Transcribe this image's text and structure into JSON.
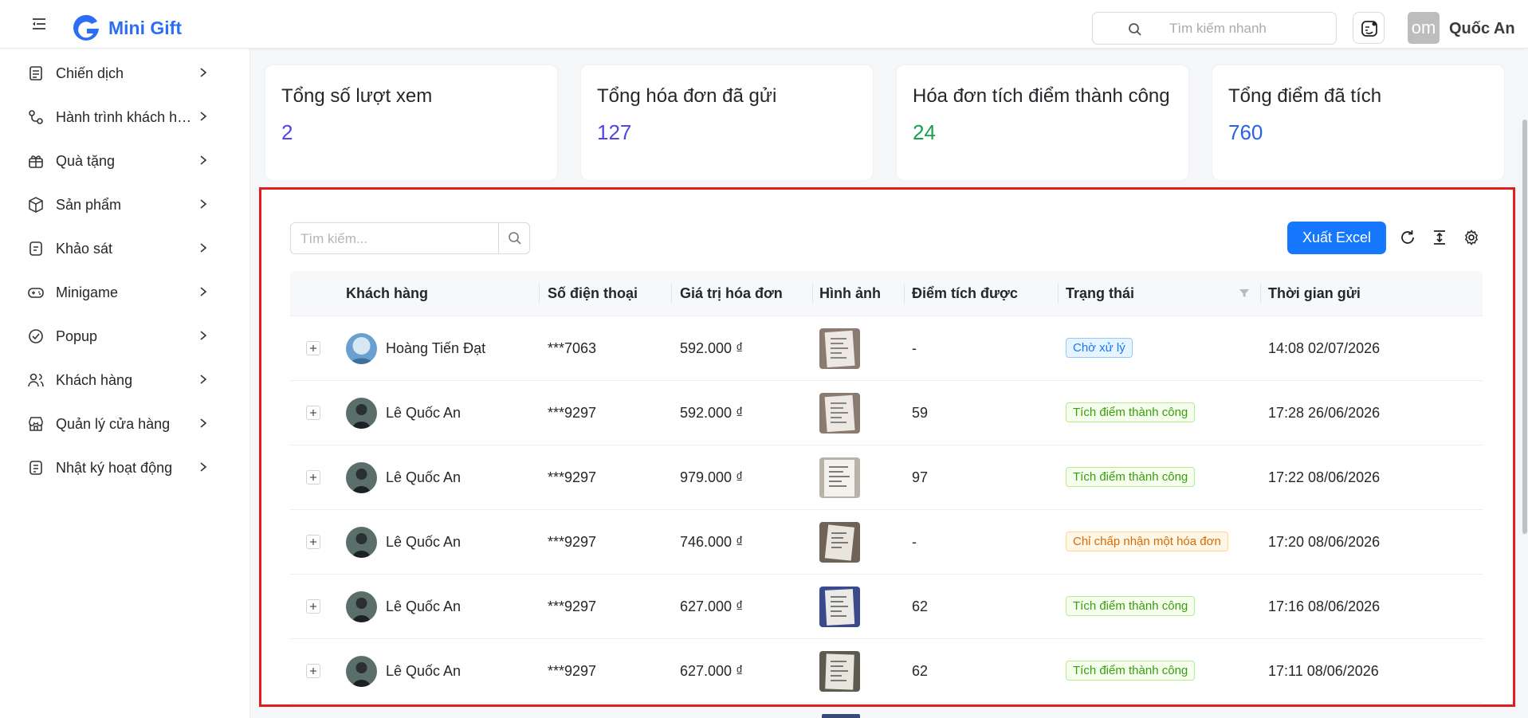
{
  "app": {
    "brand": "Mini Gift",
    "quick_search_placeholder": "Tìm kiếm nhanh",
    "user_avatar_text": "om",
    "user_name": "Quốc An"
  },
  "sidebar": {
    "items": [
      {
        "label": "Chiến dịch",
        "icon": "campaign-icon"
      },
      {
        "label": "Hành trình khách hàng",
        "icon": "journey-icon"
      },
      {
        "label": "Quà tặng",
        "icon": "gift-icon"
      },
      {
        "label": "Sản phẩm",
        "icon": "product-box-icon"
      },
      {
        "label": "Khảo sát",
        "icon": "survey-icon"
      },
      {
        "label": "Minigame",
        "icon": "gamepad-icon"
      },
      {
        "label": "Popup",
        "icon": "popup-icon"
      },
      {
        "label": "Khách hàng",
        "icon": "customers-icon"
      },
      {
        "label": "Quản lý cửa hàng",
        "icon": "store-icon"
      },
      {
        "label": "Nhật ký hoạt động",
        "icon": "activity-log-icon"
      }
    ]
  },
  "stats": [
    {
      "label": "Tổng số lượt xem",
      "value": "2",
      "color": "#4f46e5"
    },
    {
      "label": "Tổng hóa đơn đã gửi",
      "value": "127",
      "color": "#4f46e5"
    },
    {
      "label": "Hóa đơn tích điểm thành công",
      "value": "24",
      "color": "#16a34a"
    },
    {
      "label": "Tổng điểm đã tích",
      "value": "760",
      "color": "#2563eb"
    }
  ],
  "table": {
    "search_placeholder": "Tìm kiếm...",
    "export_label": "Xuất Excel",
    "columns": {
      "customer": "Khách hàng",
      "phone": "Số điện thoại",
      "amount": "Giá trị hóa đơn",
      "image": "Hình ảnh",
      "points": "Điểm tích được",
      "status": "Trạng thái",
      "sent_at": "Thời gian gửi"
    },
    "rows": [
      {
        "name": "Hoàng Tiến Đạt",
        "phone": "***7063",
        "amount": "592.000 ₫",
        "points": "-",
        "status": "Chờ xử lý",
        "status_kind": "pending",
        "sent_at": "14:08 02/07/2026"
      },
      {
        "name": "Lê Quốc An",
        "phone": "***9297",
        "amount": "592.000 ₫",
        "points": "59",
        "status": "Tích điểm thành công",
        "status_kind": "success",
        "sent_at": "17:28 26/06/2026"
      },
      {
        "name": "Lê Quốc An",
        "phone": "***9297",
        "amount": "979.000 ₫",
        "points": "97",
        "status": "Tích điểm thành công",
        "status_kind": "success",
        "sent_at": "17:22 08/06/2026"
      },
      {
        "name": "Lê Quốc An",
        "phone": "***9297",
        "amount": "746.000 ₫",
        "points": "-",
        "status": "Chỉ chấp nhận một hóa đơn",
        "status_kind": "warn",
        "sent_at": "17:20 08/06/2026"
      },
      {
        "name": "Lê Quốc An",
        "phone": "***9297",
        "amount": "627.000 ₫",
        "points": "62",
        "status": "Tích điểm thành công",
        "status_kind": "success",
        "sent_at": "17:16 08/06/2026"
      },
      {
        "name": "Lê Quốc An",
        "phone": "***9297",
        "amount": "627.000 ₫",
        "points": "62",
        "status": "Tích điểm thành công",
        "status_kind": "success",
        "sent_at": "17:11 08/06/2026"
      }
    ]
  }
}
